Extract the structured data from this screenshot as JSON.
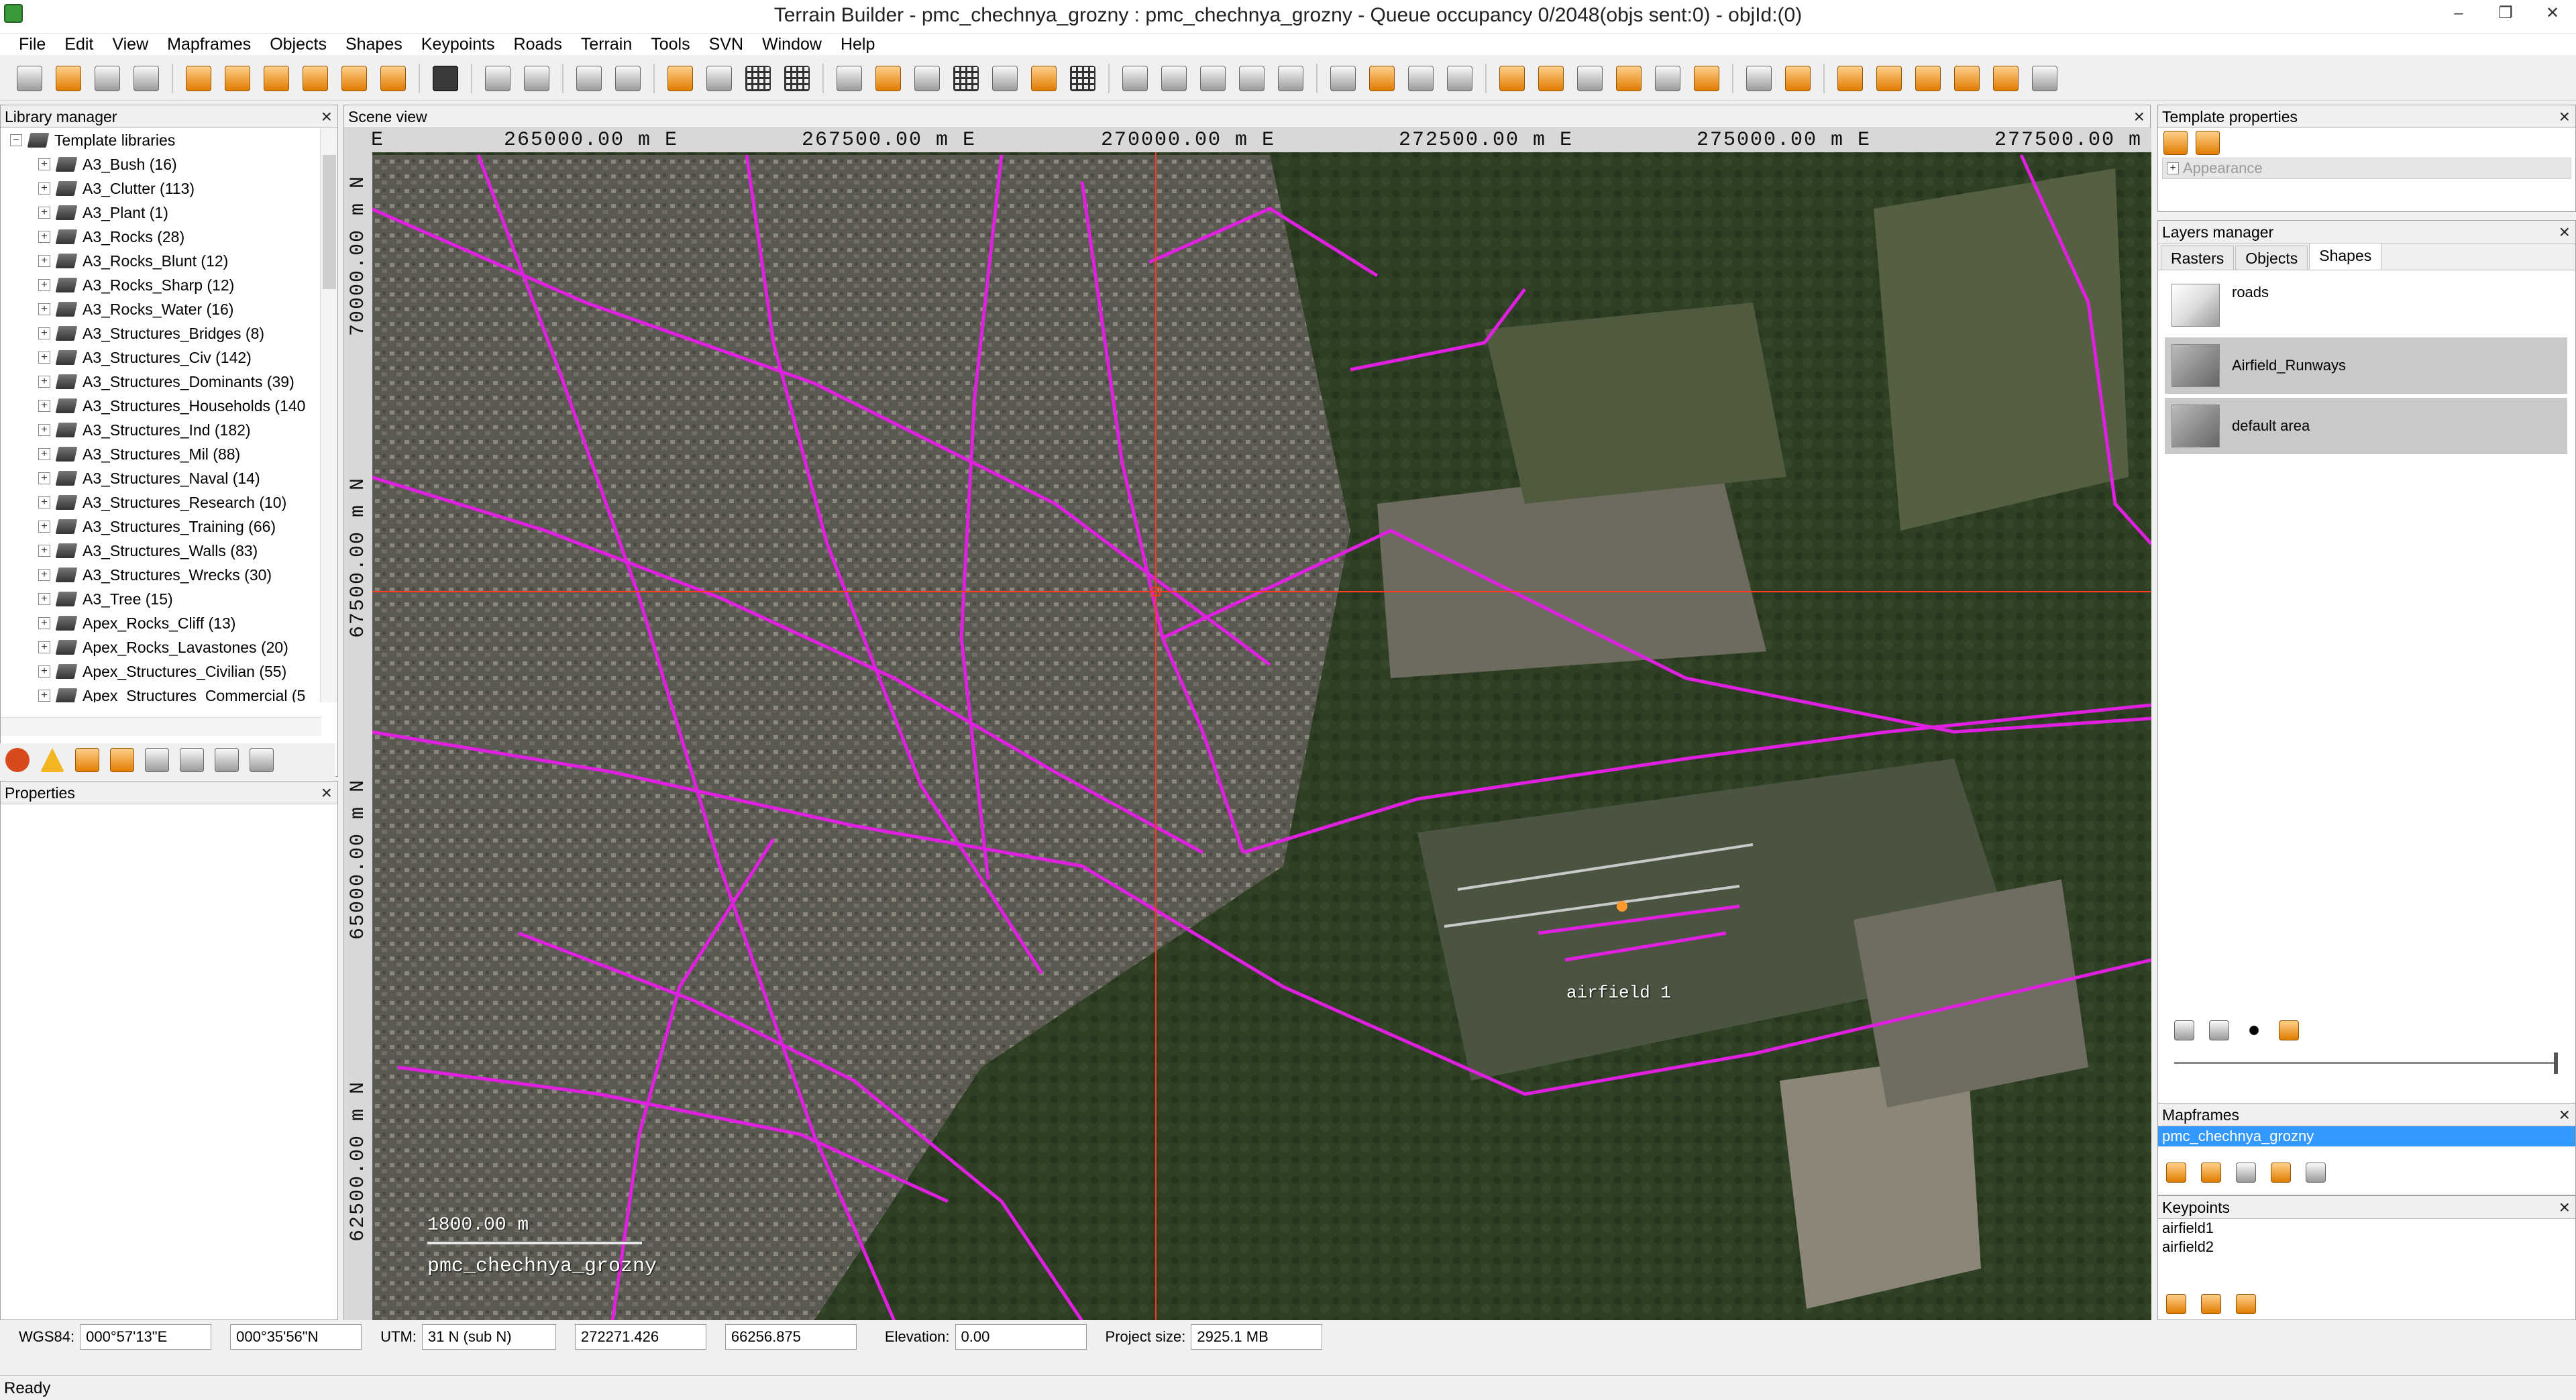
{
  "window": {
    "title": "Terrain Builder - pmc_chechnya_grozny : pmc_chechnya_grozny - Queue occupancy 0/2048(objs sent:0) - objId:(0)",
    "controls": [
      "–",
      "❐",
      "✕"
    ]
  },
  "menu": [
    "File",
    "Edit",
    "View",
    "Mapframes",
    "Objects",
    "Shapes",
    "Keypoints",
    "Roads",
    "Terrain",
    "Tools",
    "SVN",
    "Window",
    "Help"
  ],
  "library_manager": {
    "title": "Library manager",
    "root": "Template libraries",
    "items": [
      "A3_Bush (16)",
      "A3_Clutter (113)",
      "A3_Plant (1)",
      "A3_Rocks (28)",
      "A3_Rocks_Blunt (12)",
      "A3_Rocks_Sharp (12)",
      "A3_Rocks_Water (16)",
      "A3_Structures_Bridges (8)",
      "A3_Structures_Civ (142)",
      "A3_Structures_Dominants (39)",
      "A3_Structures_Households (140",
      "A3_Structures_Ind (182)",
      "A3_Structures_Mil (88)",
      "A3_Structures_Naval (14)",
      "A3_Structures_Research (10)",
      "A3_Structures_Training (66)",
      "A3_Structures_Walls (83)",
      "A3_Structures_Wrecks (30)",
      "A3_Tree (15)",
      "Apex_Rocks_Cliff (13)",
      "Apex_Rocks_Lavastones (20)",
      "Apex_Structures_Civilian (55)",
      "Apex_Structures_Commercial (5"
    ]
  },
  "properties": {
    "title": "Properties"
  },
  "scene_view": {
    "title": "Scene view",
    "easting_unit": "m E",
    "northing_unit": "m N",
    "top_corner": "m E",
    "eastings": [
      "265000.00 m E",
      "267500.00 m E",
      "270000.00 m E",
      "272500.00 m E",
      "275000.00 m E",
      "277500.00 m E"
    ],
    "northings": [
      "70000.00 m N",
      "67500.00 m N",
      "65000.00 m N",
      "62500.00 m N"
    ],
    "airfield_label": "airfield 1",
    "scale_label": "1800.00 m",
    "map_name": "pmc_chechnya_grozny"
  },
  "template_properties": {
    "title": "Template properties",
    "section": "Appearance"
  },
  "layers_manager": {
    "title": "Layers manager",
    "tabs": [
      "Rasters",
      "Objects",
      "Shapes"
    ],
    "active_tab": "Shapes",
    "layers": [
      "roads",
      "Airfield_Runways",
      "default area"
    ]
  },
  "mapframes": {
    "title": "Mapframes",
    "items": [
      "pmc_chechnya_grozny"
    ]
  },
  "keypoints": {
    "title": "Keypoints",
    "items": [
      "airfield1",
      "airfield2"
    ]
  },
  "statusbar": {
    "wgs_label": "WGS84:",
    "wgs_lon": "000°57'13\"E",
    "wgs_lat": "000°35'56\"N",
    "utm_label": "UTM:",
    "utm_zone": "31 N  (sub N)",
    "easting": "272271.426",
    "northing": "66256.875",
    "elevation_label": "Elevation:",
    "elevation": "0.00",
    "project_size_label": "Project size:",
    "project_size": "2925.1 MB"
  },
  "ready": "Ready",
  "colors": {
    "roads": "#e020e0",
    "crosshair": "#ff3b1f",
    "selection": "#3399ff"
  }
}
